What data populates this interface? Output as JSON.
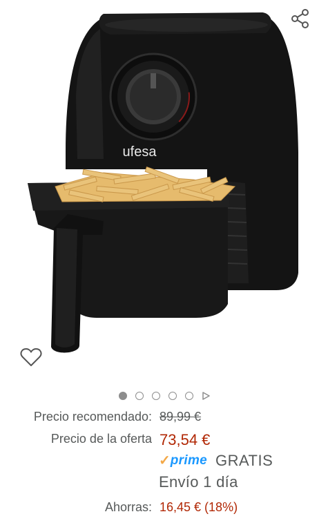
{
  "product": {
    "brand_text": "ufesa",
    "image_alt": "Ufesa air fryer with basket of fries"
  },
  "carousel": {
    "total": 5,
    "active_index": 0
  },
  "pricing": {
    "recommended_label": "Precio recomendado:",
    "recommended_value": "89,99 €",
    "offer_label": "Precio de la oferta",
    "offer_value": "73,54 €",
    "prime_word": "prime",
    "shipping_free": "GRATIS",
    "delivery_text": "Envío 1 día",
    "savings_label": "Ahorras:",
    "savings_value": "16,45 € (18%)"
  },
  "icons": {
    "share": "share-icon",
    "wishlist": "heart-outline-icon",
    "play": "play-icon"
  },
  "colors": {
    "price_red": "#b12704",
    "label_gray": "#565959",
    "prime_blue": "#1a98ff",
    "prime_orange": "#f3a847"
  }
}
